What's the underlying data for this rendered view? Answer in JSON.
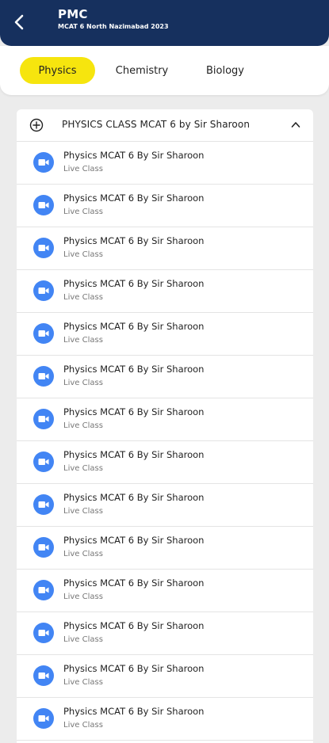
{
  "header": {
    "title": "PMC",
    "subtitle": "MCAT 6 North Nazimabad 2023",
    "background": "#16305e"
  },
  "tabs": [
    {
      "label": "Physics",
      "active": true
    },
    {
      "label": "Chemistry",
      "active": false
    },
    {
      "label": "Biology",
      "active": false
    }
  ],
  "accent": "#f6e50e",
  "section": {
    "title": "PHYSICS CLASS MCAT 6 by Sir Sharoon",
    "expanded": true,
    "icon_add": "add-circle-icon",
    "icon_toggle": "chevron-up-icon",
    "items": [
      {
        "title": "Physics MCAT 6 By Sir Sharoon",
        "subtitle": "Live Class",
        "icon": "video-camera-icon"
      },
      {
        "title": "Physics MCAT 6 By Sir Sharoon",
        "subtitle": "Live Class",
        "icon": "video-camera-icon"
      },
      {
        "title": "Physics MCAT 6 By Sir Sharoon",
        "subtitle": "Live Class",
        "icon": "video-camera-icon"
      },
      {
        "title": "Physics MCAT 6 By Sir Sharoon",
        "subtitle": "Live Class",
        "icon": "video-camera-icon"
      },
      {
        "title": "Physics MCAT 6 By Sir Sharoon",
        "subtitle": "Live Class",
        "icon": "video-camera-icon"
      },
      {
        "title": "Physics MCAT 6 By Sir Sharoon",
        "subtitle": "Live Class",
        "icon": "video-camera-icon"
      },
      {
        "title": "Physics MCAT 6 By Sir Sharoon",
        "subtitle": "Live Class",
        "icon": "video-camera-icon"
      },
      {
        "title": "Physics MCAT 6 By Sir Sharoon",
        "subtitle": "Live Class",
        "icon": "video-camera-icon"
      },
      {
        "title": "Physics MCAT 6 By Sir Sharoon",
        "subtitle": "Live Class",
        "icon": "video-camera-icon"
      },
      {
        "title": "Physics MCAT 6 By Sir Sharoon",
        "subtitle": "Live Class",
        "icon": "video-camera-icon"
      },
      {
        "title": "Physics MCAT 6 By Sir Sharoon",
        "subtitle": "Live Class",
        "icon": "video-camera-icon"
      },
      {
        "title": "Physics MCAT 6 By Sir Sharoon",
        "subtitle": "Live Class",
        "icon": "video-camera-icon"
      },
      {
        "title": "Physics MCAT 6 By Sir Sharoon",
        "subtitle": "Live Class",
        "icon": "video-camera-icon"
      },
      {
        "title": "Physics MCAT 6 By Sir Sharoon",
        "subtitle": "Live Class",
        "icon": "video-camera-icon"
      }
    ]
  }
}
